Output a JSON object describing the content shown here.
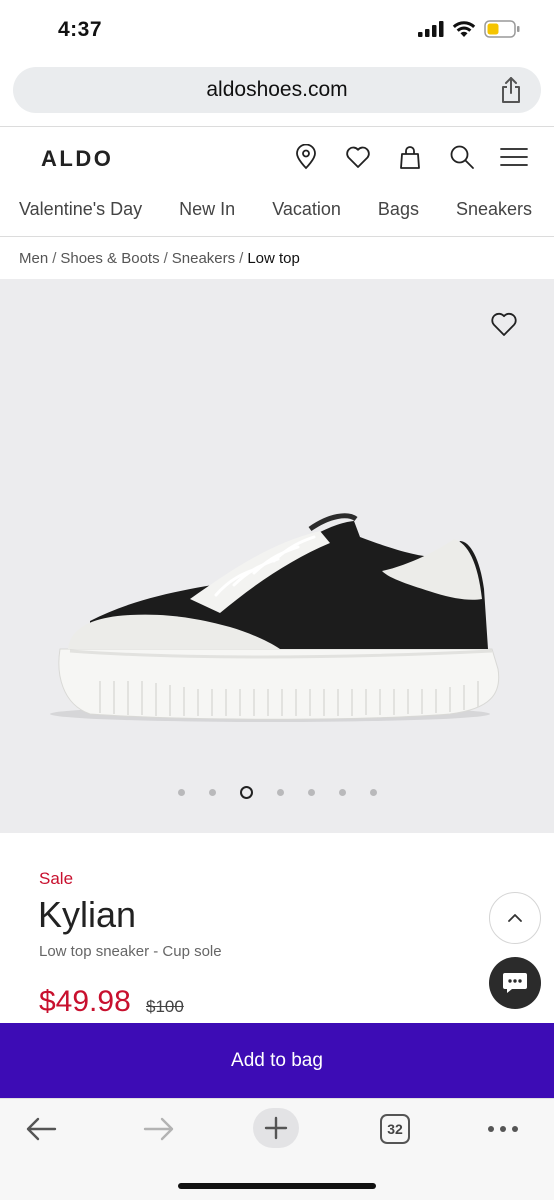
{
  "status": {
    "time": "4:37",
    "icons": [
      "signal-icon",
      "wifi-icon",
      "battery-icon"
    ],
    "battery_color": "#f5c400"
  },
  "browser": {
    "url": "aldoshoes.com",
    "tab_count": "32"
  },
  "header": {
    "logo": "ALDO",
    "icons": [
      "location-pin-icon",
      "heart-icon",
      "bag-icon",
      "search-icon",
      "menu-icon"
    ]
  },
  "categories": [
    "Valentine's Day",
    "New In",
    "Vacation",
    "Bags",
    "Sneakers"
  ],
  "breadcrumb": {
    "items": [
      "Men",
      "Shoes & Boots",
      "Sneakers"
    ],
    "current": "Low top",
    "separator": "/"
  },
  "gallery": {
    "dot_count": 7,
    "active_index": 2
  },
  "product": {
    "sale_label": "Sale",
    "name": "Kylian",
    "description": "Low top sneaker - Cup sole",
    "price": "$49.98",
    "original_price": "$100"
  },
  "actions": {
    "add_to_bag": "Add to bag"
  },
  "colors": {
    "sale_red": "#c8102e",
    "primary_purple": "#3d0cb5"
  }
}
